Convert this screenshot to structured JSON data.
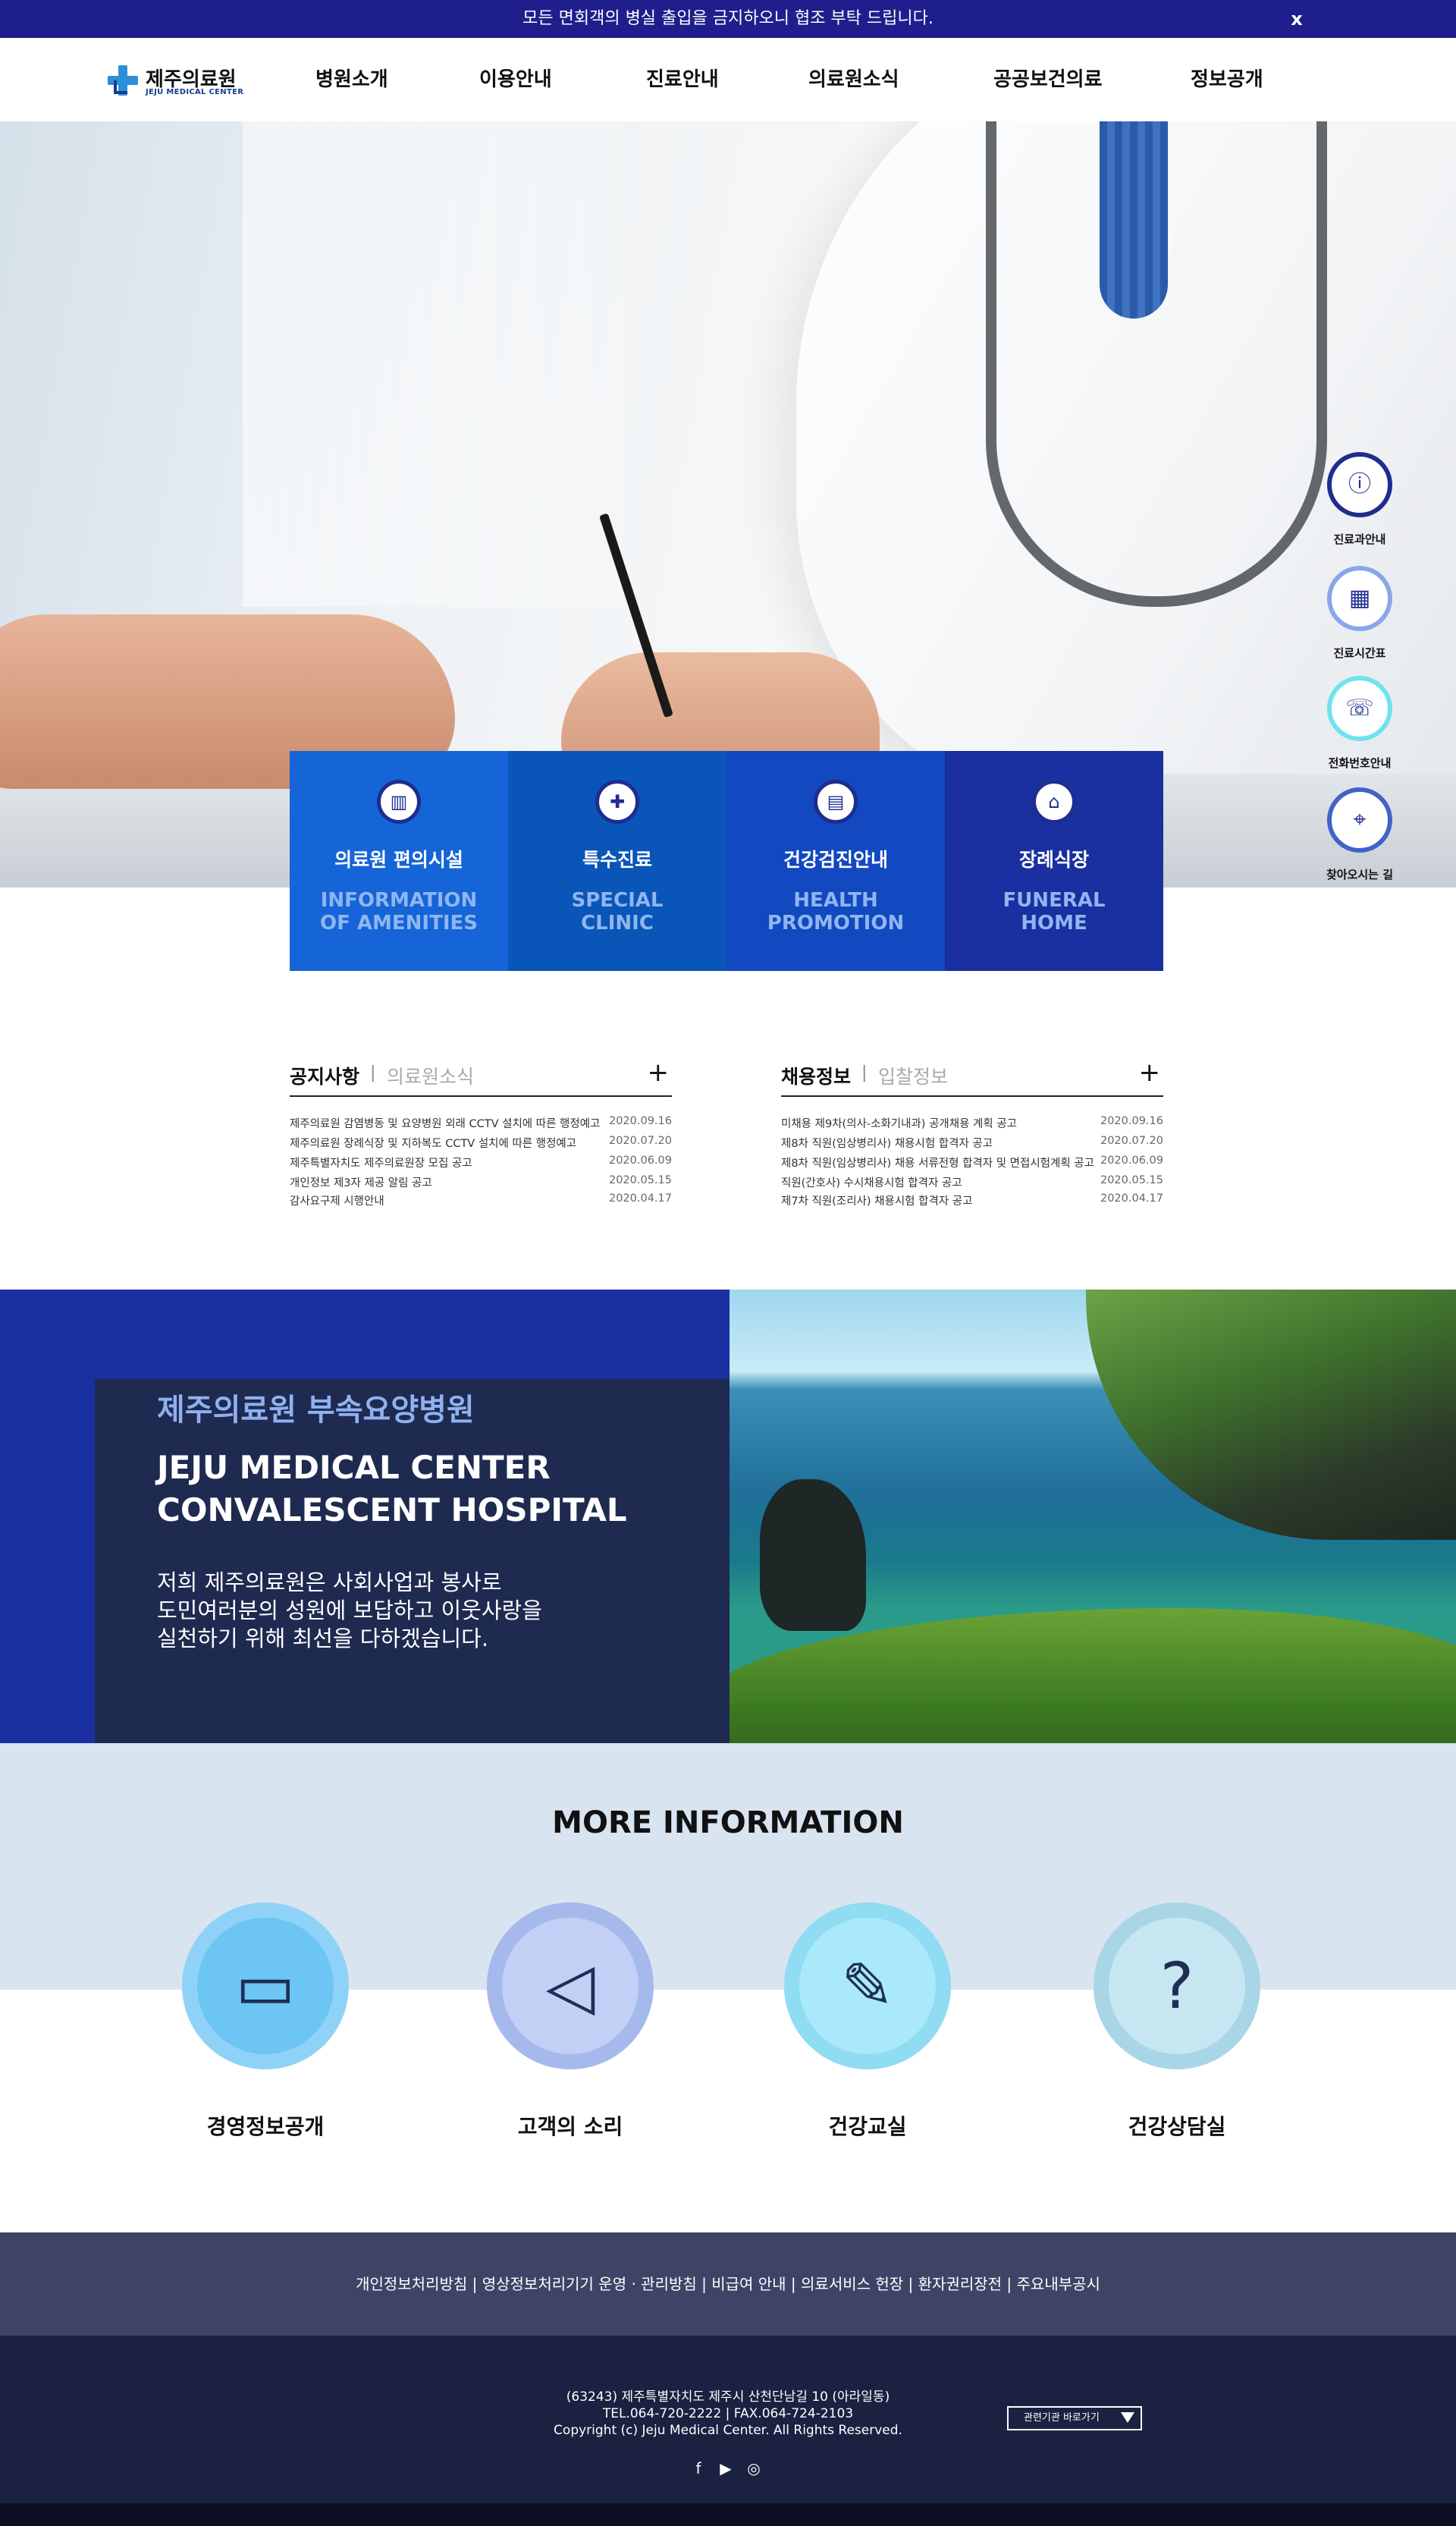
{
  "notice": {
    "text": "모든 면회객의 병실 출입을 금지하오니 협조 부탁 드립니다.",
    "close": "x"
  },
  "header": {
    "logo_name": "제주의료원",
    "logo_sub": "JEJU MEDICAL CENTER",
    "nav": [
      "병원소개",
      "이용안내",
      "진료안내",
      "의료원소식",
      "공공보건의료",
      "정보공개"
    ]
  },
  "hero": {
    "slide_count": 4,
    "active_slide": 1
  },
  "quick_menu": [
    {
      "label": "진료과안내",
      "icon": "info-icon"
    },
    {
      "label": "진료시간표",
      "icon": "calendar-icon"
    },
    {
      "label": "전화번호안내",
      "icon": "phone-icon"
    },
    {
      "label": "찾아오시는 길",
      "icon": "map-pin-icon"
    }
  ],
  "features": [
    {
      "title": "의료원 편의시설",
      "en": "INFORMATION\nOF AMENITIES",
      "icon": "building-icon",
      "color": "#1565d8"
    },
    {
      "title": "특수진료",
      "en": "SPECIAL\nCLINIC",
      "icon": "medical-icon",
      "color": "#0a55b8"
    },
    {
      "title": "건강검진안내",
      "en": "HEALTH\nPROMOTION",
      "icon": "checkup-icon",
      "color": "#1248c0"
    },
    {
      "title": "장례식장",
      "en": "FUNERAL\nHOME",
      "icon": "funeral-icon",
      "color": "#1a2fa0"
    }
  ],
  "notice_board": {
    "tab_active": "공지사항",
    "tab_inactive": "의료원소식",
    "separator": "|",
    "more": "+",
    "rows": [
      {
        "title": "제주의료원 감염병동 및 요양병원 외래 CCTV 설치에 따른 행정예고",
        "date": "2020.09.16"
      },
      {
        "title": "제주의료원 장례식장 및 지하복도 CCTV 설치에 따른 행정예고",
        "date": "2020.07.20"
      },
      {
        "title": "제주특별자치도 제주의료원장 모집 공고",
        "date": "2020.06.09"
      },
      {
        "title": "개인정보 제3자 제공 알림 공고",
        "date": "2020.05.15"
      },
      {
        "title": "감사요구제 시행안내",
        "date": "2020.04.17"
      }
    ]
  },
  "recruit_board": {
    "tab_active": "채용정보",
    "tab_inactive": "입찰정보",
    "separator": "|",
    "more": "+",
    "rows": [
      {
        "title": "미채용 제9차(의사-소화기내과) 공개채용 계획 공고",
        "date": "2020.09.16"
      },
      {
        "title": "제8차 직원(임상병리사) 채용시험 합격자 공고",
        "date": "2020.07.20"
      },
      {
        "title": "제8차 직원(임상병리사) 채용 서류전형 합격자 및 면접시험계획 공고",
        "date": "2020.06.09"
      },
      {
        "title": "직원(간호사) 수시채용시험 합격자 공고",
        "date": "2020.05.15"
      },
      {
        "title": "제7차 직원(조리사) 채용시험 합격자 공고",
        "date": "2020.04.17"
      }
    ]
  },
  "convalescent": {
    "title_kr": "제주의료원 부속요양병원",
    "title_en_1": "JEJU MEDICAL CENTER",
    "title_en_2": "CONVALESCENT HOSPITAL",
    "desc_1": "저희 제주의료원은 사회사업과 봉사로",
    "desc_2": "도민여러분의 성원에 보답하고 이웃사랑을",
    "desc_3": "실천하기 위해 최선을 다하겠습니다."
  },
  "more_info": {
    "title": "MORE INFORMATION",
    "items": [
      {
        "label": "경영정보공개",
        "icon": "monitor-icon",
        "ring": "#8ed3f7",
        "core": "#6cc5f3"
      },
      {
        "label": "고객의 소리",
        "icon": "megaphone-icon",
        "ring": "#a5b9ec",
        "core": "#c2d0f5"
      },
      {
        "label": "건강교실",
        "icon": "document-edit-icon",
        "ring": "#8fdcf3",
        "core": "#a9e9fb"
      },
      {
        "label": "건강상담실",
        "icon": "question-chat-icon",
        "ring": "#a8d6e6",
        "core": "#c6e7f2"
      }
    ]
  },
  "footer": {
    "links": [
      "개인정보처리방침",
      "영상정보처리기기 운영 · 관리방침",
      "비급여 안내",
      "의료서비스 헌장",
      "환자권리장전",
      "주요내부공시"
    ],
    "link_sep": " | ",
    "address": "(63243) 제주특별자치도 제주시 산천단남길 10 (아라일동)",
    "tel": "TEL.064-720-2222  |  FAX.064-724-2103",
    "copyright": "Copyright (c) Jeju Medical Center. All Rights Reserved.",
    "related_sites": "관련기관 바로가기",
    "sns": [
      "facebook-icon",
      "youtube-icon",
      "instagram-icon"
    ]
  },
  "colors": {
    "notice_bg": "#1e1f8c",
    "brand_navy": "#1a2fa0",
    "footer_bg": "#1b2140",
    "footer_links_bg": "#3e4466"
  }
}
